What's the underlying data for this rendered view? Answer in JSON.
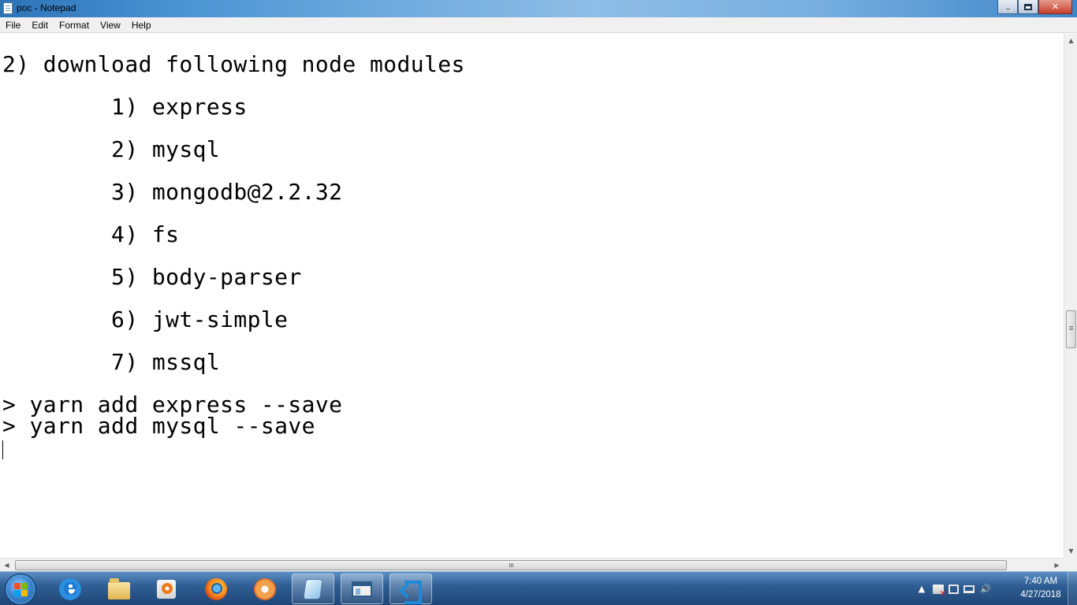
{
  "window": {
    "title": "poc - Notepad",
    "minimize_glyph": "",
    "close_glyph": "✕"
  },
  "menu": {
    "items": [
      "File",
      "Edit",
      "Format",
      "View",
      "Help"
    ]
  },
  "document": {
    "lines": [
      "2) download following node modules",
      "        1) express",
      "        2) mysql",
      "        3) mongodb@2.2.32",
      "        4) fs",
      "        5) body-parser",
      "        6) jwt-simple",
      "        7) mssql",
      "> yarn add express --save",
      "> yarn add mysql --save"
    ]
  },
  "scrollbars": {
    "up_arrow": "▲",
    "down_arrow": "▼",
    "left_arrow": "◀",
    "right_arrow": "▶"
  },
  "taskbar": {
    "pinned": [
      {
        "name": "internet-explorer-icon",
        "open": false
      },
      {
        "name": "file-explorer-icon",
        "open": false
      },
      {
        "name": "media-player-icon",
        "open": false
      },
      {
        "name": "firefox-icon",
        "open": false
      },
      {
        "name": "flower-app-icon",
        "open": false
      },
      {
        "name": "notepad-icon",
        "open": true
      },
      {
        "name": "window-app-icon",
        "open": true
      },
      {
        "name": "vscode-icon",
        "open": true
      }
    ],
    "tray": {
      "show_hidden_glyph": "▲",
      "volume_glyph": "🔊"
    },
    "clock": {
      "time": "7:40 AM",
      "date": "4/27/2018"
    }
  },
  "colors": {
    "titlebar_accent": "#4d95d4",
    "taskbar": "#2f5f95",
    "text": "#000000"
  }
}
